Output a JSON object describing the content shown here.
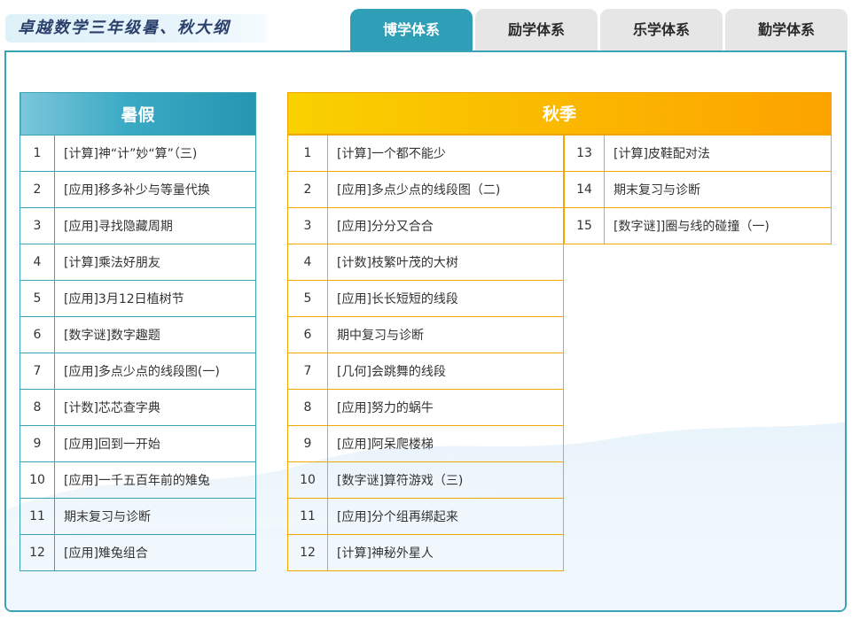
{
  "page_title": "卓越数学三年级暑、秋大纲",
  "tabs": [
    {
      "label": "博学体系",
      "active": true
    },
    {
      "label": "励学体系",
      "active": false
    },
    {
      "label": "乐学体系",
      "active": false
    },
    {
      "label": "勤学体系",
      "active": false
    }
  ],
  "colors": {
    "accent_teal": "#2f9fb7",
    "summer_border": "#3aa3b8",
    "autumn_border": "#f0a800",
    "autumn_header_start": "#f9d100",
    "autumn_header_end": "#fca300"
  },
  "summer": {
    "header": "暑假",
    "rows": [
      {
        "num": "1",
        "title": "[计算]神“计”妙“算”（三)"
      },
      {
        "num": "2",
        "title": "[应用]移多补少与等量代换"
      },
      {
        "num": "3",
        "title": "[应用]寻找隐藏周期"
      },
      {
        "num": "4",
        "title": "[计算]乘法好朋友"
      },
      {
        "num": "5",
        "title": "[应用]3月12日植树节"
      },
      {
        "num": "6",
        "title": "[数字谜]数字趣题"
      },
      {
        "num": "7",
        "title": "[应用]多点少点的线段图(一)"
      },
      {
        "num": "8",
        "title": "[计数]芯芯查字典"
      },
      {
        "num": "9",
        "title": "[应用]回到一开始"
      },
      {
        "num": "10",
        "title": "[应用]一千五百年前的雉兔"
      },
      {
        "num": "11",
        "title": "期末复习与诊断"
      },
      {
        "num": "12",
        "title": "[应用]雉兔组合"
      }
    ]
  },
  "autumn": {
    "header": "秋季",
    "left_rows": [
      {
        "num": "1",
        "title": "[计算]一个都不能少"
      },
      {
        "num": "2",
        "title": "[应用]多点少点的线段图（二)"
      },
      {
        "num": "3",
        "title": "[应用]分分又合合"
      },
      {
        "num": "4",
        "title": "[计数]枝繁叶茂的大树"
      },
      {
        "num": "5",
        "title": "[应用]长长短短的线段"
      },
      {
        "num": "6",
        "title": "期中复习与诊断"
      },
      {
        "num": "7",
        "title": "[几何]会跳舞的线段"
      },
      {
        "num": "8",
        "title": "[应用]努力的蜗牛"
      },
      {
        "num": "9",
        "title": "[应用]阿呆爬楼梯"
      },
      {
        "num": "10",
        "title": "[数字谜]算符游戏（三)"
      },
      {
        "num": "11",
        "title": "[应用]分个组再绑起来"
      },
      {
        "num": "12",
        "title": "[计算]神秘外星人"
      }
    ],
    "right_rows": [
      {
        "num": "13",
        "title": "[计算]皮鞋配对法"
      },
      {
        "num": "14",
        "title": "期末复习与诊断"
      },
      {
        "num": "15",
        "title": "[数字谜]]圈与线的碰撞（一)"
      }
    ]
  }
}
